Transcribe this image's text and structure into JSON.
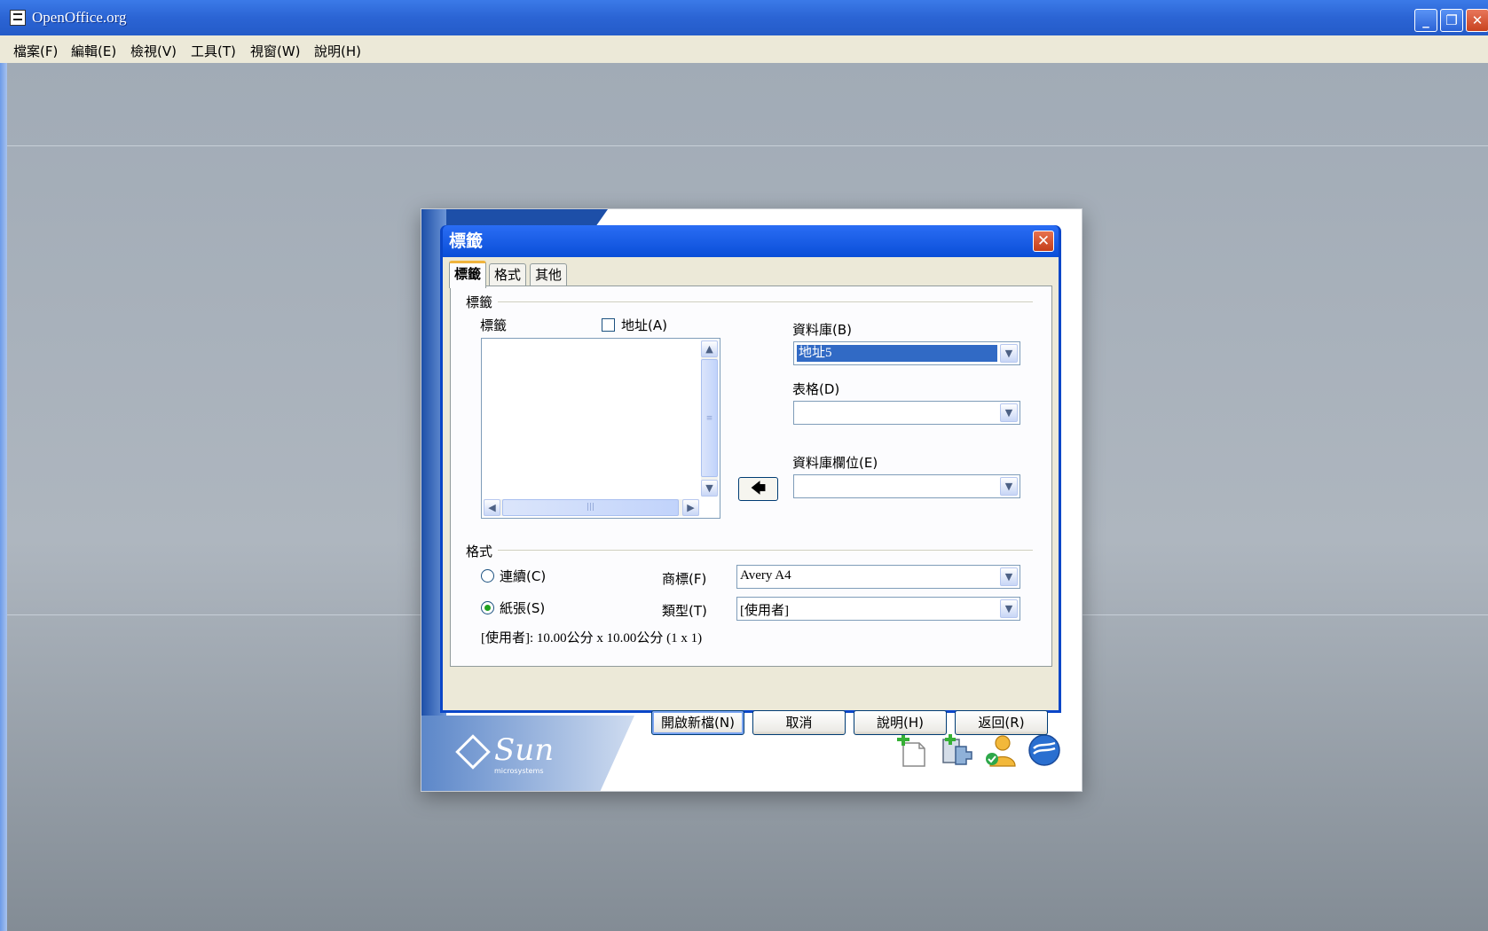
{
  "window": {
    "title": "OpenOffice.org",
    "controls": {
      "minimize": "_",
      "restore": "❐",
      "close": "✕"
    }
  },
  "menubar": {
    "items": [
      "檔案(F)",
      "編輯(E)",
      "檢視(V)",
      "工具(T)",
      "視窗(W)",
      "說明(H)"
    ]
  },
  "dialog": {
    "title": "標籤",
    "close": "✕",
    "tabs": [
      "標籤",
      "格式",
      "其他"
    ],
    "active_tab": "標籤",
    "label_group": {
      "heading": "標籤",
      "label_text": "標籤",
      "address_checkbox": "地址(A)",
      "address_checked": false,
      "database_label": "資料庫(B)",
      "database_value": "地址5",
      "table_label": "表格(D)",
      "table_value": "",
      "db_field_label": "資料庫欄位(E)",
      "db_field_value": "",
      "insert_arrow": "🡄"
    },
    "format_group": {
      "heading": "格式",
      "continuous_label": "連續(C)",
      "continuous_selected": false,
      "sheet_label": "紙張(S)",
      "sheet_selected": true,
      "brand_label": "商標(F)",
      "brand_value": "Avery A4",
      "type_label": "類型(T)",
      "type_value": "[使用者]",
      "info": "[使用者]: 10.00公分 x 10.00公分 (1 x 1)"
    },
    "buttons": {
      "new_document": "開啟新檔(N)",
      "cancel": "取消",
      "help": "說明(H)",
      "reset": "返回(R)"
    }
  },
  "splash": {
    "brand": "Sun",
    "brand_sub": "microsystems"
  },
  "colors": {
    "titlebar": "#2b64d4",
    "selection": "#316ac5",
    "workspace": "#a1abb6"
  }
}
